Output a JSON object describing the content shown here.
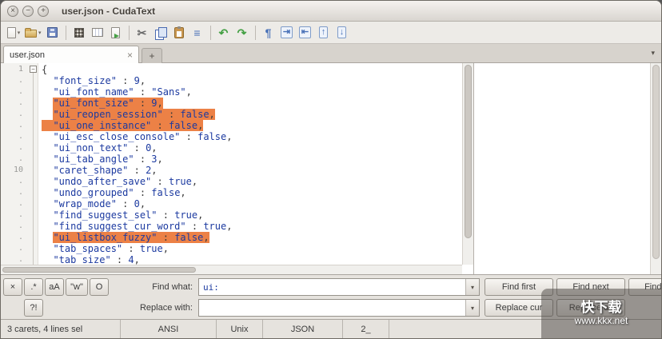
{
  "titlebar": {
    "title": "user.json - CudaText",
    "close_glyph": "×",
    "minimize_glyph": "−",
    "maximize_glyph": "+"
  },
  "toolbar": {
    "items": [
      {
        "name": "new-file-button",
        "kind": "page",
        "dropdown": true
      },
      {
        "name": "open-file-button",
        "kind": "folder",
        "dropdown": true
      },
      {
        "name": "save-button",
        "kind": "floppy"
      },
      {
        "kind": "sep"
      },
      {
        "name": "binary-view-button",
        "kind": "darkgrid"
      },
      {
        "name": "char-map-button",
        "kind": "grid"
      },
      {
        "name": "reload-file-button",
        "kind": "pagearrow"
      },
      {
        "kind": "sep"
      },
      {
        "name": "cut-button",
        "kind": "glyph",
        "glyph": "✂",
        "color": "#6a6a6a"
      },
      {
        "name": "copy-button",
        "kind": "copy"
      },
      {
        "name": "paste-button",
        "kind": "paste"
      },
      {
        "name": "select-all-button",
        "kind": "glyph",
        "glyph": "≡",
        "color": "#4a72b8"
      },
      {
        "kind": "sep"
      },
      {
        "name": "undo-button",
        "kind": "glyph",
        "glyph": "↶",
        "color": "#44a044"
      },
      {
        "name": "redo-button",
        "kind": "glyph",
        "glyph": "↷",
        "color": "#44a044"
      },
      {
        "kind": "sep"
      },
      {
        "name": "show-whitespace-button",
        "kind": "glyph",
        "glyph": "¶",
        "color": "#4a72b8"
      },
      {
        "name": "indent-button",
        "kind": "boxglyph",
        "glyph": "⇥",
        "color": "#4a72b8"
      },
      {
        "name": "unindent-button",
        "kind": "boxglyph",
        "glyph": "⇤",
        "color": "#4a72b8"
      },
      {
        "name": "move-line-up-button",
        "kind": "boxglyph",
        "glyph": "↑",
        "color": "#4a72b8"
      },
      {
        "name": "move-line-down-button",
        "kind": "boxglyph",
        "glyph": "↓",
        "color": "#4a72b8"
      }
    ]
  },
  "tabbar": {
    "active_tab": "user.json",
    "close_glyph": "×",
    "new_tab_label": "+",
    "menu_glyph": "▾"
  },
  "editor": {
    "fold_glyph": "−",
    "selection_color": "#EC8146",
    "lines": [
      {
        "num": "1",
        "raw": "{",
        "sel": "none"
      },
      {
        "num": ".",
        "key": "font_size",
        "val": "9",
        "sel": "none"
      },
      {
        "num": ".",
        "key": "ui_font_name",
        "val": "\"Sans\"",
        "sel": "none"
      },
      {
        "num": ".",
        "key": "ui_font_size",
        "val": "9",
        "sel": "text"
      },
      {
        "num": ".",
        "key": "ui_reopen_session",
        "val": "false",
        "sel": "text"
      },
      {
        "num": ".",
        "key": "ui_one_instance",
        "val": "false",
        "sel": "line"
      },
      {
        "num": ".",
        "key": "ui_esc_close_console",
        "val": "false",
        "sel": "none"
      },
      {
        "num": ".",
        "key": "ui_non_text",
        "val": "0",
        "sel": "none"
      },
      {
        "num": ".",
        "key": "ui_tab_angle",
        "val": "3",
        "sel": "none"
      },
      {
        "num": "10",
        "key": "caret_shape",
        "val": "2",
        "sel": "none"
      },
      {
        "num": ".",
        "key": "undo_after_save",
        "val": "true",
        "sel": "none"
      },
      {
        "num": ".",
        "key": "undo_grouped",
        "val": "false",
        "sel": "none"
      },
      {
        "num": ".",
        "key": "wrap_mode",
        "val": "0",
        "sel": "none"
      },
      {
        "num": ".",
        "key": "find_suggest_sel",
        "val": "true",
        "sel": "none"
      },
      {
        "num": ".",
        "key": "find_suggest_cur_word",
        "val": "true",
        "sel": "none"
      },
      {
        "num": ".",
        "key": "ui_listbox_fuzzy",
        "val": "false",
        "sel": "text"
      },
      {
        "num": ".",
        "key": "tab_spaces",
        "val": "true",
        "sel": "none"
      },
      {
        "num": ".",
        "key": "tab_size",
        "val": "4",
        "sel": "none"
      }
    ]
  },
  "find_panel": {
    "close_label": "×",
    "regex_label": ".*",
    "case_label": "aA",
    "word_label": "\"w\"",
    "wrap_label": "O",
    "confirm_label": "?!",
    "find_label": "Find what:",
    "find_value": "ui:",
    "replace_label": "Replace with:",
    "replace_value": "",
    "dropdown_glyph": "▾",
    "find_first_label": "Find first",
    "find_next_label": "Find next",
    "find_prev_label": "Find prev",
    "replace_cur_label": "Replace cur",
    "replace_all_label": "Replace all"
  },
  "statusbar": {
    "caret_info": "3 carets, 4 lines sel",
    "encoding": "ANSI",
    "line_endings": "Unix",
    "lexer": "JSON",
    "tab_info": "2_"
  },
  "watermark": {
    "logo": "快下载",
    "url": "www.kkx.net"
  }
}
